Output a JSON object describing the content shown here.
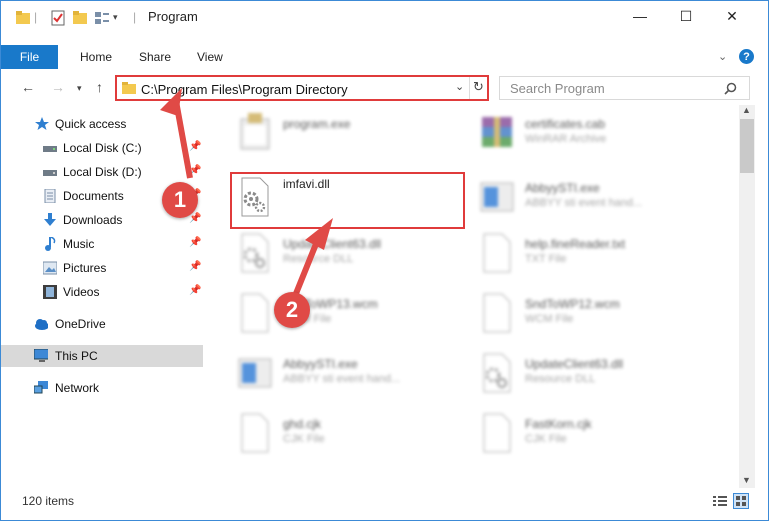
{
  "window": {
    "title": "Program",
    "controls": {
      "minimize": "—",
      "maximize": "☐",
      "close": "✕"
    }
  },
  "ribbon": {
    "tabs": [
      "File",
      "Home",
      "Share",
      "View"
    ],
    "help": "?"
  },
  "address": {
    "path": "C:\\Program Files\\Program Directory",
    "search_placeholder": "Search Program"
  },
  "sidebar": {
    "items": [
      {
        "label": "Quick access",
        "icon": "star-icon",
        "pinned": false
      },
      {
        "label": "Local Disk (C:)",
        "icon": "drive-icon",
        "pinned": true
      },
      {
        "label": "Local Disk (D:)",
        "icon": "drive-icon",
        "pinned": true
      },
      {
        "label": "Documents",
        "icon": "documents-icon",
        "pinned": true
      },
      {
        "label": "Downloads",
        "icon": "download-icon",
        "pinned": true
      },
      {
        "label": "Music",
        "icon": "music-icon",
        "pinned": true
      },
      {
        "label": "Pictures",
        "icon": "pictures-icon",
        "pinned": true
      },
      {
        "label": "Videos",
        "icon": "video-icon",
        "pinned": true
      },
      {
        "label": "OneDrive",
        "icon": "cloud-icon",
        "pinned": false
      },
      {
        "label": "This PC",
        "icon": "computer-icon",
        "pinned": false,
        "selected": true
      },
      {
        "label": "Network",
        "icon": "network-icon",
        "pinned": false
      }
    ]
  },
  "files": {
    "left": [
      {
        "name": "program.exe",
        "type": "",
        "icon": "exe-icon"
      },
      {
        "name": "imfavi.dll",
        "type": "",
        "icon": "dll-gear-icon",
        "highlighted": true
      },
      {
        "name": "UpdateClient63.dll",
        "type": "Resource DLL",
        "icon": "dll-gear-icon"
      },
      {
        "name": "SndToWP13.wcm",
        "type": "WCM File",
        "icon": "blank-file-icon"
      },
      {
        "name": "AbbyySTI.exe",
        "type": "ABBYY sti event hand...",
        "icon": "exe-icon"
      },
      {
        "name": "ghd.cjk",
        "type": "CJK File",
        "icon": "blank-file-icon"
      }
    ],
    "right": [
      {
        "name": "certificates.cab",
        "type": "WinRAR Archive",
        "icon": "archive-icon"
      },
      {
        "name": "AbbyySTI.exe",
        "type": "ABBYY sti event hand...",
        "icon": "exe-icon"
      },
      {
        "name": "help.fineReader.txt",
        "type": "TXT File",
        "icon": "blank-file-icon"
      },
      {
        "name": "SndToWP12.wcm",
        "type": "WCM File",
        "icon": "blank-file-icon"
      },
      {
        "name": "UpdateClient63.dll",
        "type": "Resource DLL",
        "icon": "dll-gear-icon"
      },
      {
        "name": "FastKorn.cjk",
        "type": "CJK File",
        "icon": "blank-file-icon"
      }
    ]
  },
  "status": {
    "count": "120 items"
  },
  "callouts": {
    "one": "1",
    "two": "2"
  },
  "colors": {
    "accent": "#1979ca",
    "highlight": "#e03b3b",
    "marker": "#e04a46"
  }
}
